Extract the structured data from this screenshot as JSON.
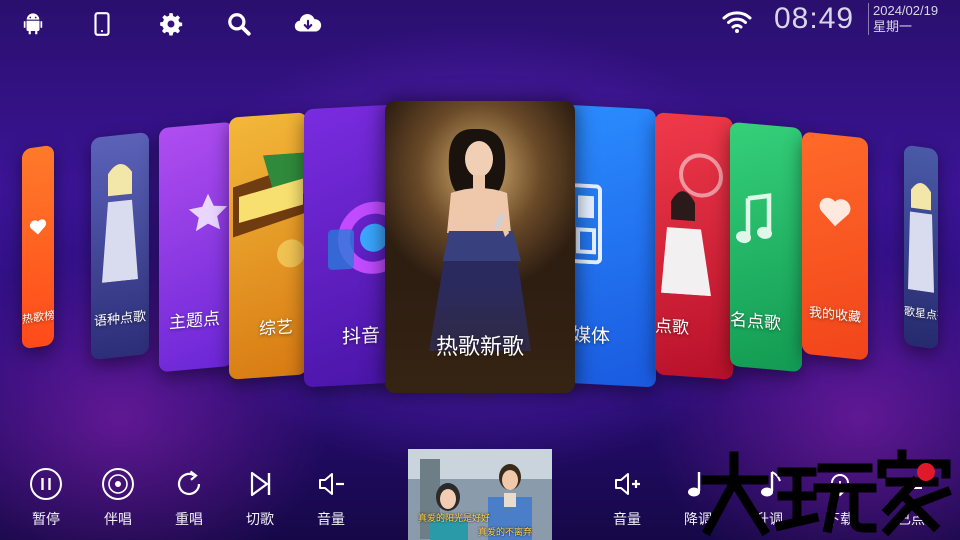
{
  "status_bar": {
    "icons": [
      "android-icon",
      "phone-icon",
      "gear-icon",
      "search-icon",
      "cloud-download-icon"
    ],
    "wifi_icon": "wifi-icon",
    "time": "08:49",
    "date": "2024/02/19",
    "weekday": "星期一"
  },
  "carousel": {
    "cards": [
      {
        "label": "热歌新歌",
        "selected": true,
        "color": "#8a6a3a"
      },
      {
        "label": "抖音",
        "color": "#6a2fd0"
      },
      {
        "label": "媒体",
        "color": "#1f7bf0"
      },
      {
        "label": "综艺",
        "color": "#e9a020"
      },
      {
        "label": "点歌",
        "color": "#d71f3a"
      },
      {
        "label": "主题点",
        "color": "#8a44e0"
      },
      {
        "label": "名点歌",
        "color": "#23b86a"
      },
      {
        "label": "语种点歌",
        "color": "#4a4f9a"
      },
      {
        "label": "我的收藏",
        "color": "#ff5a2a"
      },
      {
        "label": "热歌榜",
        "color": "#ff6a20"
      },
      {
        "label": "歌星点歌",
        "color": "#3c3f86"
      }
    ]
  },
  "controls": {
    "left": [
      {
        "label": "暂停",
        "icon": "pause-icon"
      },
      {
        "label": "伴唱",
        "icon": "vinyl-icon"
      },
      {
        "label": "重唱",
        "icon": "replay-icon"
      },
      {
        "label": "切歌",
        "icon": "skip-next-icon"
      },
      {
        "label": "音量",
        "icon": "volume-down-icon"
      }
    ],
    "right": [
      {
        "label": "音量",
        "icon": "volume-up-icon"
      },
      {
        "label": "降调",
        "icon": "note-down-icon"
      },
      {
        "label": "升调",
        "icon": "note-up-icon"
      },
      {
        "label": "下载",
        "icon": "download-icon"
      },
      {
        "label": "已点",
        "icon": "check-list-icon"
      }
    ]
  },
  "video": {
    "lyric_line_1": "真爱的阳光是好好",
    "lyric_line_2": "真爱的不离弃"
  },
  "watermark": "大玩家",
  "colors": {
    "accent": "#6a2fd0",
    "bg": "#2a0f6e"
  }
}
